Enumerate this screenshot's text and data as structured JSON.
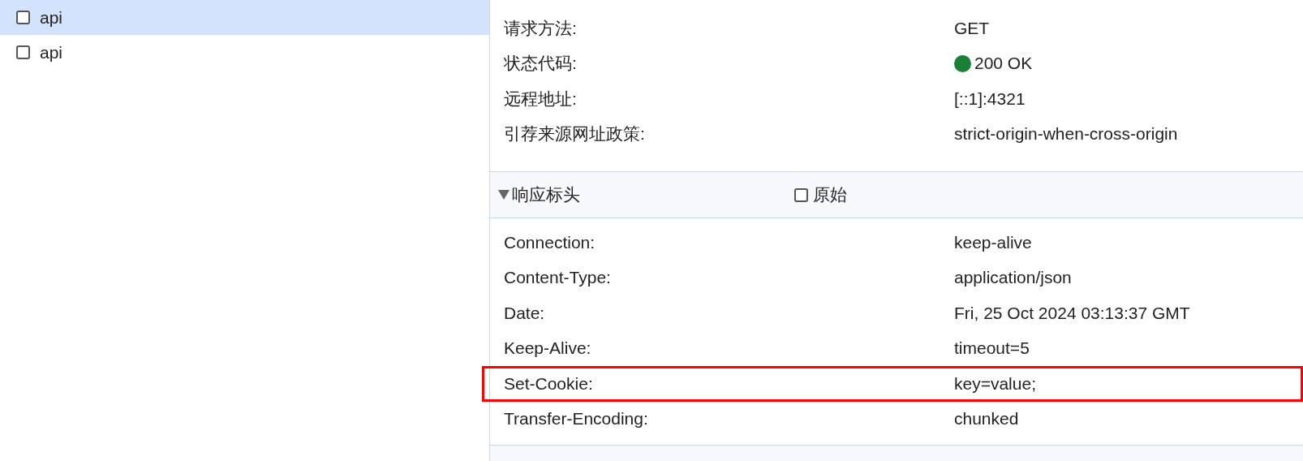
{
  "requests": [
    {
      "name": "api",
      "selected": true,
      "checked": false
    },
    {
      "name": "api",
      "selected": false,
      "checked": false
    }
  ],
  "general": [
    {
      "label": "请求方法:",
      "value": "GET"
    },
    {
      "label": "状态代码:",
      "value": "200 OK",
      "color": "#1a7f37"
    },
    {
      "label": "远程地址:",
      "value": "[::1]:4321"
    },
    {
      "label": "引荐来源网址政策:",
      "value": "strict-origin-when-cross-origin"
    }
  ],
  "response_headers": {
    "title": "响应标头",
    "expanded": true,
    "raw_label": "原始",
    "raw_checked": false,
    "rows": [
      {
        "name": "Connection:",
        "value": "keep-alive",
        "highlighted": false
      },
      {
        "name": "Content-Type:",
        "value": "application/json",
        "highlighted": false
      },
      {
        "name": "Date:",
        "value": "Fri, 25 Oct 2024 03:13:37 GMT",
        "highlighted": false
      },
      {
        "name": "Keep-Alive:",
        "value": "timeout=5",
        "highlighted": false
      },
      {
        "name": "Set-Cookie:",
        "value": "key=value;",
        "highlighted": true
      },
      {
        "name": "Transfer-Encoding:",
        "value": "chunked",
        "highlighted": false
      }
    ]
  }
}
